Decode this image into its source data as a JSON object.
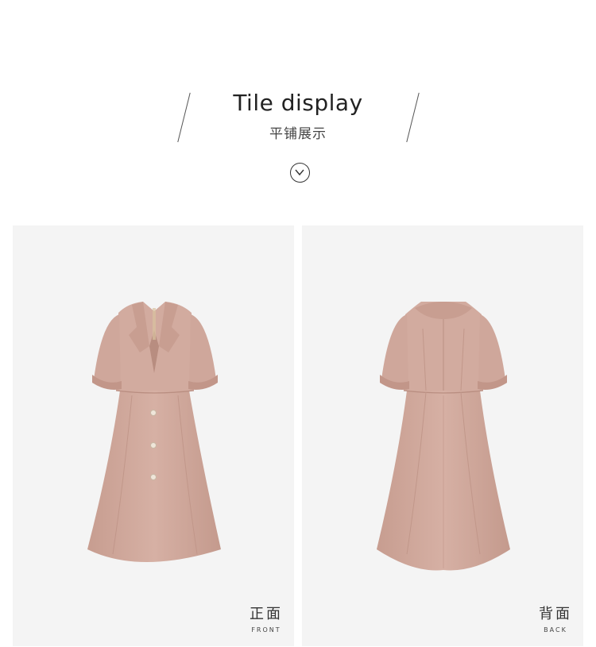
{
  "header": {
    "title_en": "Tile display",
    "title_cn": "平铺展示"
  },
  "icons": {
    "scroll": "chevron-down-circle-icon"
  },
  "colors": {
    "dress": "#d2ab9f",
    "panel_bg": "#f4f4f4"
  },
  "panels": [
    {
      "label_cn": "正面",
      "label_en": "FRONT"
    },
    {
      "label_cn": "背面",
      "label_en": "BACK"
    }
  ]
}
